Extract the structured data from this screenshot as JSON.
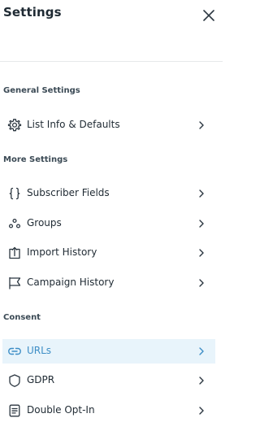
{
  "header": {
    "title": "Settings"
  },
  "sections": [
    {
      "label": "General Settings",
      "items": [
        {
          "label": "List Info & Defaults",
          "icon": "gear-icon"
        }
      ]
    },
    {
      "label": "More Settings",
      "items": [
        {
          "label": "Subscriber Fields",
          "icon": "braces-icon"
        },
        {
          "label": "Groups",
          "icon": "groups-dots-icon"
        },
        {
          "label": "Import History",
          "icon": "import-icon"
        },
        {
          "label": "Campaign History",
          "icon": "flag-icon"
        }
      ]
    },
    {
      "label": "Consent",
      "items": [
        {
          "label": "URLs",
          "icon": "link-icon",
          "active": true
        },
        {
          "label": "GDPR",
          "icon": "shield-icon"
        },
        {
          "label": "Double Opt-In",
          "icon": "document-icon"
        }
      ]
    }
  ],
  "colors": {
    "active_bg": "#e8f4fb",
    "active_text": "#3d8ec6",
    "text": "#1f2a33",
    "divider": "#e6e8ea"
  }
}
